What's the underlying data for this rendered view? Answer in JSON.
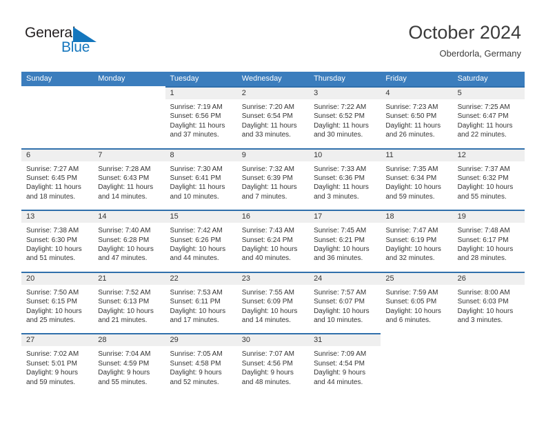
{
  "brand": {
    "name_part1": "General",
    "name_part2": "Blue",
    "logo_icon": "flag-triangle-icon",
    "accent_color": "#1476bd"
  },
  "header": {
    "title": "October 2024",
    "subtitle": "Oberdorla, Germany"
  },
  "calendar": {
    "header_bg": "#3b7dbd",
    "cell_band_bg": "#efefef",
    "cell_top_border": "#2f6fab",
    "weekday_labels": [
      "Sunday",
      "Monday",
      "Tuesday",
      "Wednesday",
      "Thursday",
      "Friday",
      "Saturday"
    ],
    "weeks": [
      [
        {
          "empty": true
        },
        {
          "empty": true
        },
        {
          "day": "1",
          "sunrise": "Sunrise: 7:19 AM",
          "sunset": "Sunset: 6:56 PM",
          "daylight_line1": "Daylight: 11 hours",
          "daylight_line2": "and 37 minutes."
        },
        {
          "day": "2",
          "sunrise": "Sunrise: 7:20 AM",
          "sunset": "Sunset: 6:54 PM",
          "daylight_line1": "Daylight: 11 hours",
          "daylight_line2": "and 33 minutes."
        },
        {
          "day": "3",
          "sunrise": "Sunrise: 7:22 AM",
          "sunset": "Sunset: 6:52 PM",
          "daylight_line1": "Daylight: 11 hours",
          "daylight_line2": "and 30 minutes."
        },
        {
          "day": "4",
          "sunrise": "Sunrise: 7:23 AM",
          "sunset": "Sunset: 6:50 PM",
          "daylight_line1": "Daylight: 11 hours",
          "daylight_line2": "and 26 minutes."
        },
        {
          "day": "5",
          "sunrise": "Sunrise: 7:25 AM",
          "sunset": "Sunset: 6:47 PM",
          "daylight_line1": "Daylight: 11 hours",
          "daylight_line2": "and 22 minutes."
        }
      ],
      [
        {
          "day": "6",
          "sunrise": "Sunrise: 7:27 AM",
          "sunset": "Sunset: 6:45 PM",
          "daylight_line1": "Daylight: 11 hours",
          "daylight_line2": "and 18 minutes."
        },
        {
          "day": "7",
          "sunrise": "Sunrise: 7:28 AM",
          "sunset": "Sunset: 6:43 PM",
          "daylight_line1": "Daylight: 11 hours",
          "daylight_line2": "and 14 minutes."
        },
        {
          "day": "8",
          "sunrise": "Sunrise: 7:30 AM",
          "sunset": "Sunset: 6:41 PM",
          "daylight_line1": "Daylight: 11 hours",
          "daylight_line2": "and 10 minutes."
        },
        {
          "day": "9",
          "sunrise": "Sunrise: 7:32 AM",
          "sunset": "Sunset: 6:39 PM",
          "daylight_line1": "Daylight: 11 hours",
          "daylight_line2": "and 7 minutes."
        },
        {
          "day": "10",
          "sunrise": "Sunrise: 7:33 AM",
          "sunset": "Sunset: 6:36 PM",
          "daylight_line1": "Daylight: 11 hours",
          "daylight_line2": "and 3 minutes."
        },
        {
          "day": "11",
          "sunrise": "Sunrise: 7:35 AM",
          "sunset": "Sunset: 6:34 PM",
          "daylight_line1": "Daylight: 10 hours",
          "daylight_line2": "and 59 minutes."
        },
        {
          "day": "12",
          "sunrise": "Sunrise: 7:37 AM",
          "sunset": "Sunset: 6:32 PM",
          "daylight_line1": "Daylight: 10 hours",
          "daylight_line2": "and 55 minutes."
        }
      ],
      [
        {
          "day": "13",
          "sunrise": "Sunrise: 7:38 AM",
          "sunset": "Sunset: 6:30 PM",
          "daylight_line1": "Daylight: 10 hours",
          "daylight_line2": "and 51 minutes."
        },
        {
          "day": "14",
          "sunrise": "Sunrise: 7:40 AM",
          "sunset": "Sunset: 6:28 PM",
          "daylight_line1": "Daylight: 10 hours",
          "daylight_line2": "and 47 minutes."
        },
        {
          "day": "15",
          "sunrise": "Sunrise: 7:42 AM",
          "sunset": "Sunset: 6:26 PM",
          "daylight_line1": "Daylight: 10 hours",
          "daylight_line2": "and 44 minutes."
        },
        {
          "day": "16",
          "sunrise": "Sunrise: 7:43 AM",
          "sunset": "Sunset: 6:24 PM",
          "daylight_line1": "Daylight: 10 hours",
          "daylight_line2": "and 40 minutes."
        },
        {
          "day": "17",
          "sunrise": "Sunrise: 7:45 AM",
          "sunset": "Sunset: 6:21 PM",
          "daylight_line1": "Daylight: 10 hours",
          "daylight_line2": "and 36 minutes."
        },
        {
          "day": "18",
          "sunrise": "Sunrise: 7:47 AM",
          "sunset": "Sunset: 6:19 PM",
          "daylight_line1": "Daylight: 10 hours",
          "daylight_line2": "and 32 minutes."
        },
        {
          "day": "19",
          "sunrise": "Sunrise: 7:48 AM",
          "sunset": "Sunset: 6:17 PM",
          "daylight_line1": "Daylight: 10 hours",
          "daylight_line2": "and 28 minutes."
        }
      ],
      [
        {
          "day": "20",
          "sunrise": "Sunrise: 7:50 AM",
          "sunset": "Sunset: 6:15 PM",
          "daylight_line1": "Daylight: 10 hours",
          "daylight_line2": "and 25 minutes."
        },
        {
          "day": "21",
          "sunrise": "Sunrise: 7:52 AM",
          "sunset": "Sunset: 6:13 PM",
          "daylight_line1": "Daylight: 10 hours",
          "daylight_line2": "and 21 minutes."
        },
        {
          "day": "22",
          "sunrise": "Sunrise: 7:53 AM",
          "sunset": "Sunset: 6:11 PM",
          "daylight_line1": "Daylight: 10 hours",
          "daylight_line2": "and 17 minutes."
        },
        {
          "day": "23",
          "sunrise": "Sunrise: 7:55 AM",
          "sunset": "Sunset: 6:09 PM",
          "daylight_line1": "Daylight: 10 hours",
          "daylight_line2": "and 14 minutes."
        },
        {
          "day": "24",
          "sunrise": "Sunrise: 7:57 AM",
          "sunset": "Sunset: 6:07 PM",
          "daylight_line1": "Daylight: 10 hours",
          "daylight_line2": "and 10 minutes."
        },
        {
          "day": "25",
          "sunrise": "Sunrise: 7:59 AM",
          "sunset": "Sunset: 6:05 PM",
          "daylight_line1": "Daylight: 10 hours",
          "daylight_line2": "and 6 minutes."
        },
        {
          "day": "26",
          "sunrise": "Sunrise: 8:00 AM",
          "sunset": "Sunset: 6:03 PM",
          "daylight_line1": "Daylight: 10 hours",
          "daylight_line2": "and 3 minutes."
        }
      ],
      [
        {
          "day": "27",
          "sunrise": "Sunrise: 7:02 AM",
          "sunset": "Sunset: 5:01 PM",
          "daylight_line1": "Daylight: 9 hours",
          "daylight_line2": "and 59 minutes."
        },
        {
          "day": "28",
          "sunrise": "Sunrise: 7:04 AM",
          "sunset": "Sunset: 4:59 PM",
          "daylight_line1": "Daylight: 9 hours",
          "daylight_line2": "and 55 minutes."
        },
        {
          "day": "29",
          "sunrise": "Sunrise: 7:05 AM",
          "sunset": "Sunset: 4:58 PM",
          "daylight_line1": "Daylight: 9 hours",
          "daylight_line2": "and 52 minutes."
        },
        {
          "day": "30",
          "sunrise": "Sunrise: 7:07 AM",
          "sunset": "Sunset: 4:56 PM",
          "daylight_line1": "Daylight: 9 hours",
          "daylight_line2": "and 48 minutes."
        },
        {
          "day": "31",
          "sunrise": "Sunrise: 7:09 AM",
          "sunset": "Sunset: 4:54 PM",
          "daylight_line1": "Daylight: 9 hours",
          "daylight_line2": "and 44 minutes."
        },
        {
          "empty": true
        },
        {
          "empty": true
        }
      ]
    ]
  }
}
